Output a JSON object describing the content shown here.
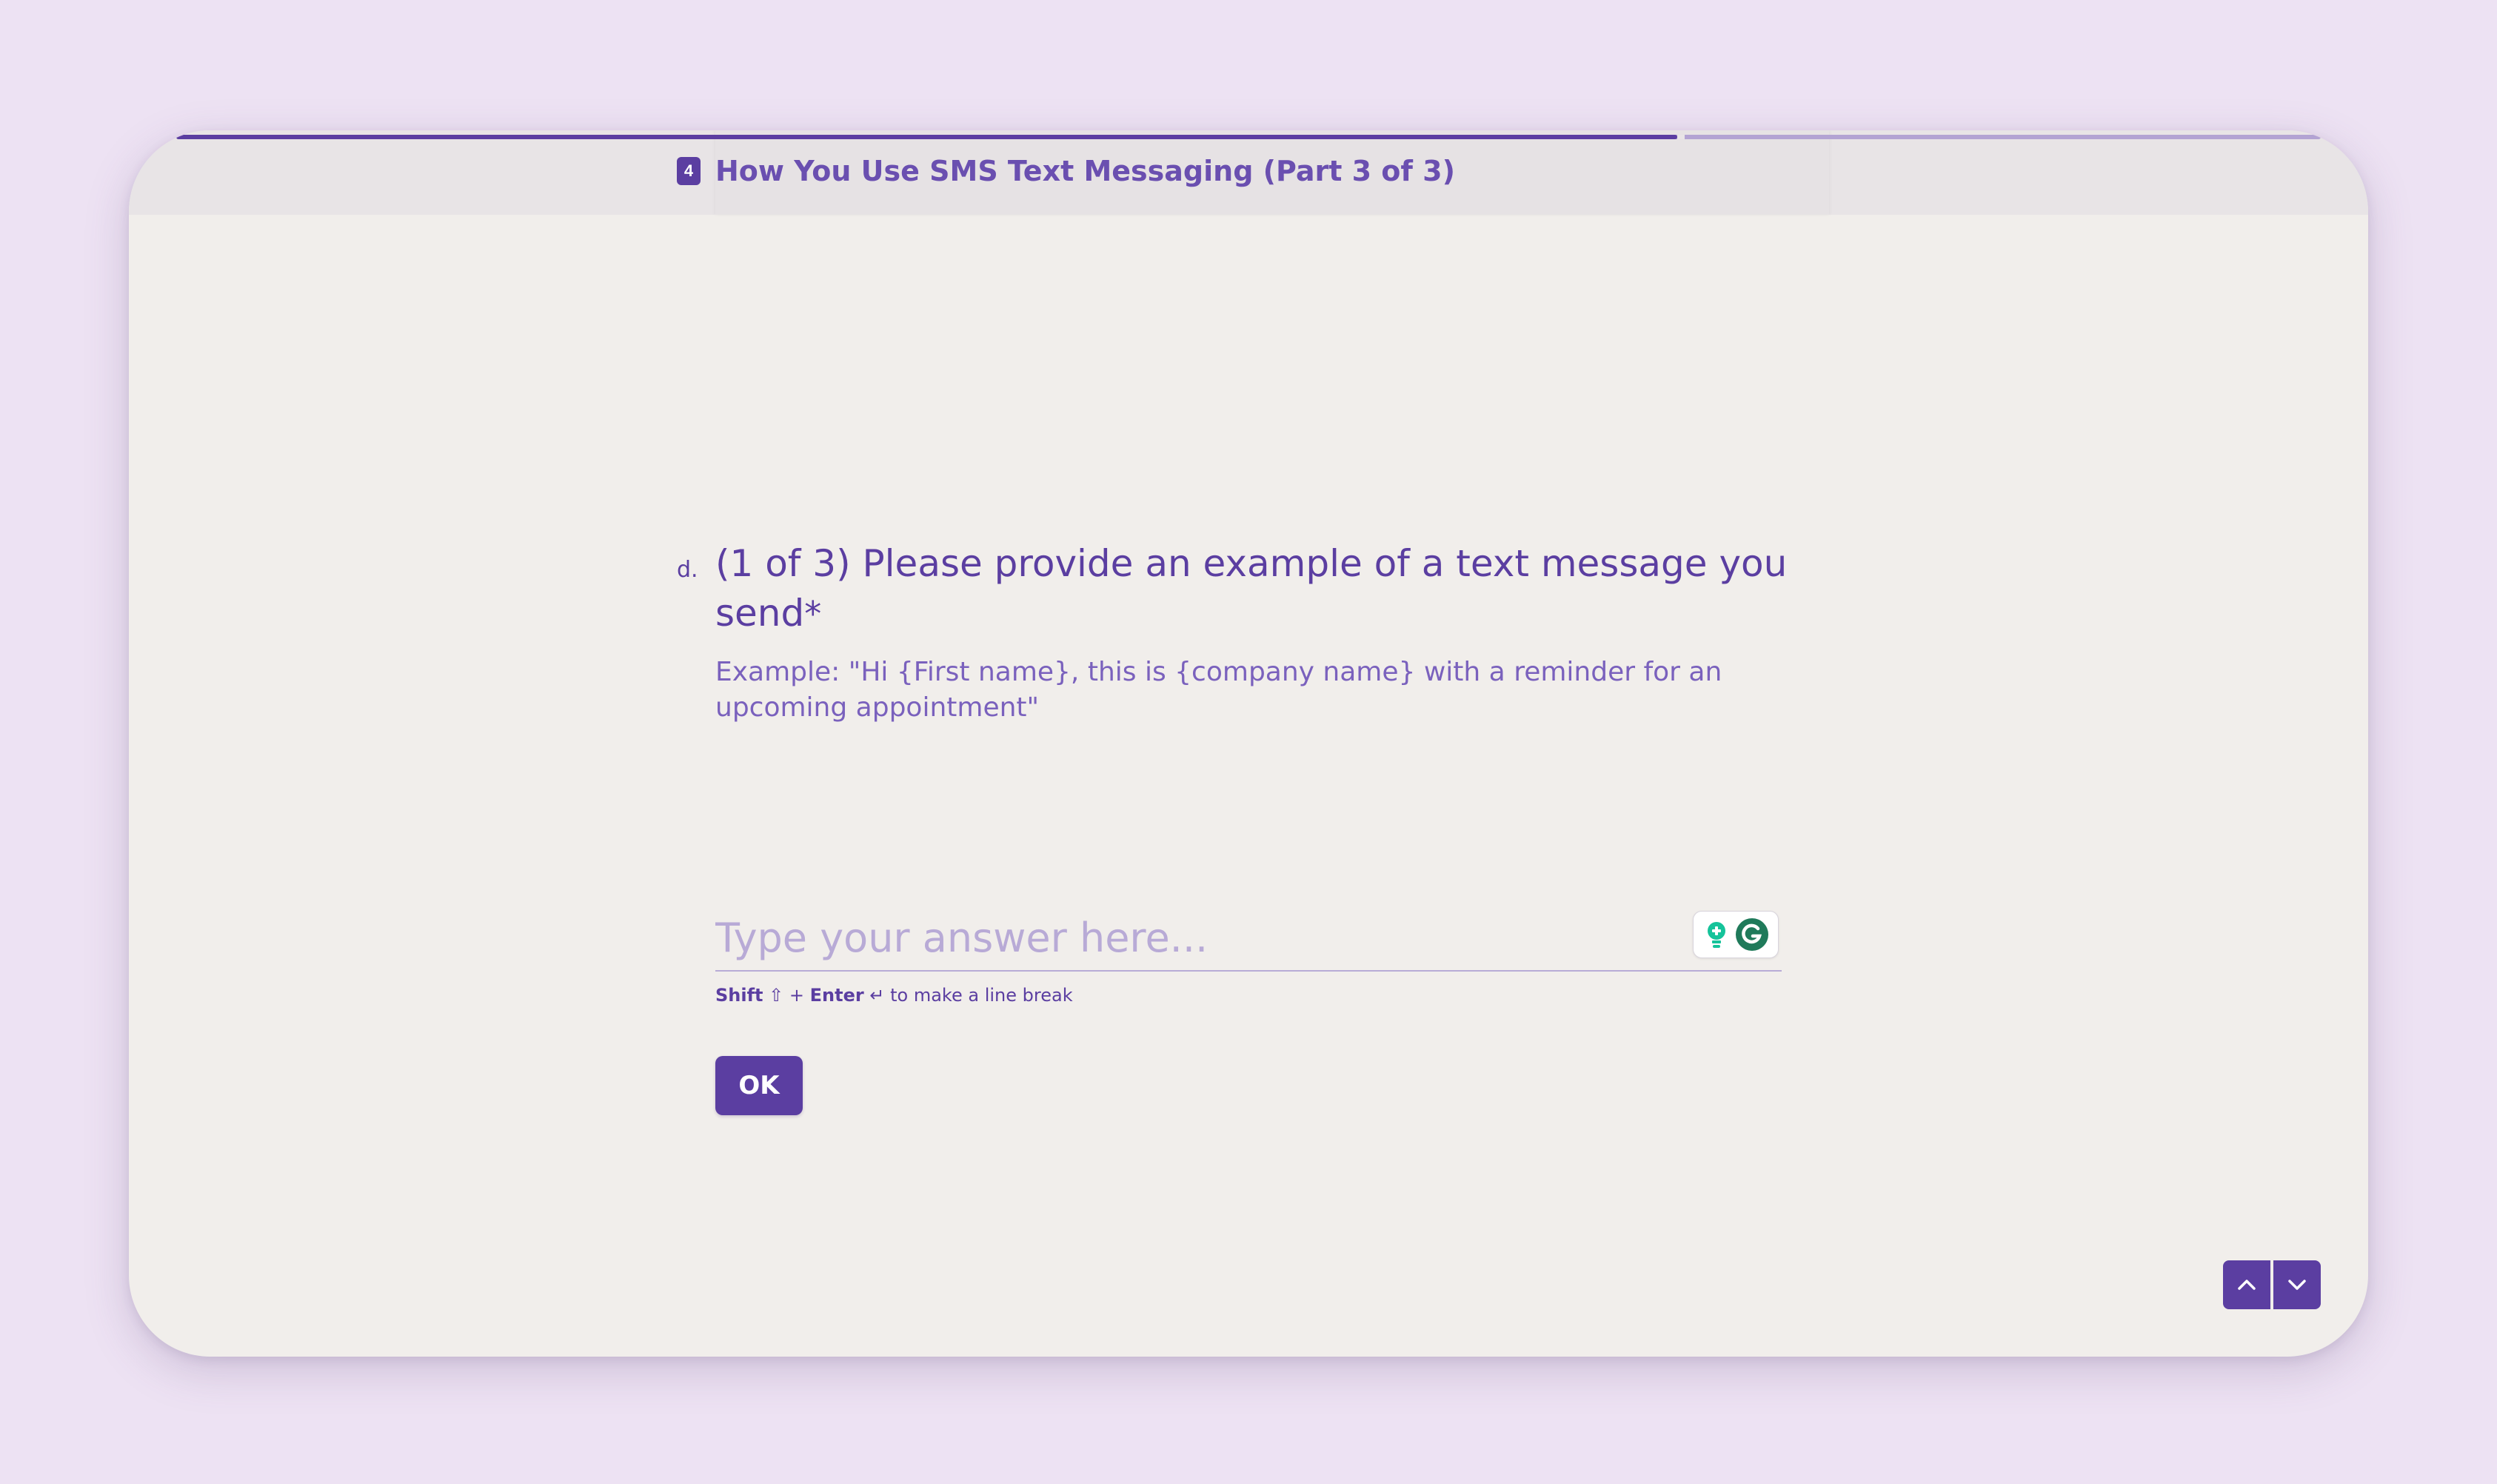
{
  "header": {
    "section_number": "4",
    "section_title": "How You Use SMS Text Messaging (Part 3 of 3)",
    "progress_fraction": 0.7
  },
  "question": {
    "index_label": "d.",
    "title": "(1 of 3) Please provide an example of a text message you send",
    "required_marker": "*",
    "description": "Example: \"Hi {First name}, this is {company name} with a reminder for an upcoming appointment\""
  },
  "answer": {
    "placeholder": "Type your answer here...",
    "value": ""
  },
  "hint": {
    "shift_label": "Shift",
    "shift_symbol": "⇧",
    "plus": "+",
    "enter_label": "Enter",
    "enter_symbol": "↵",
    "text": "to make a line break"
  },
  "ok_button": {
    "label": "OK"
  },
  "extension_icons": {
    "bulb": "lightbulb-icon",
    "grammarly": "grammarly-icon"
  },
  "navigation": {
    "up_icon": "chevron-up-icon",
    "down_icon": "chevron-down-icon"
  },
  "colors": {
    "accent": "#5b3ea1",
    "background": "#ede2f3",
    "card": "#f1eeeb",
    "grammarly_green": "#15c39a"
  }
}
